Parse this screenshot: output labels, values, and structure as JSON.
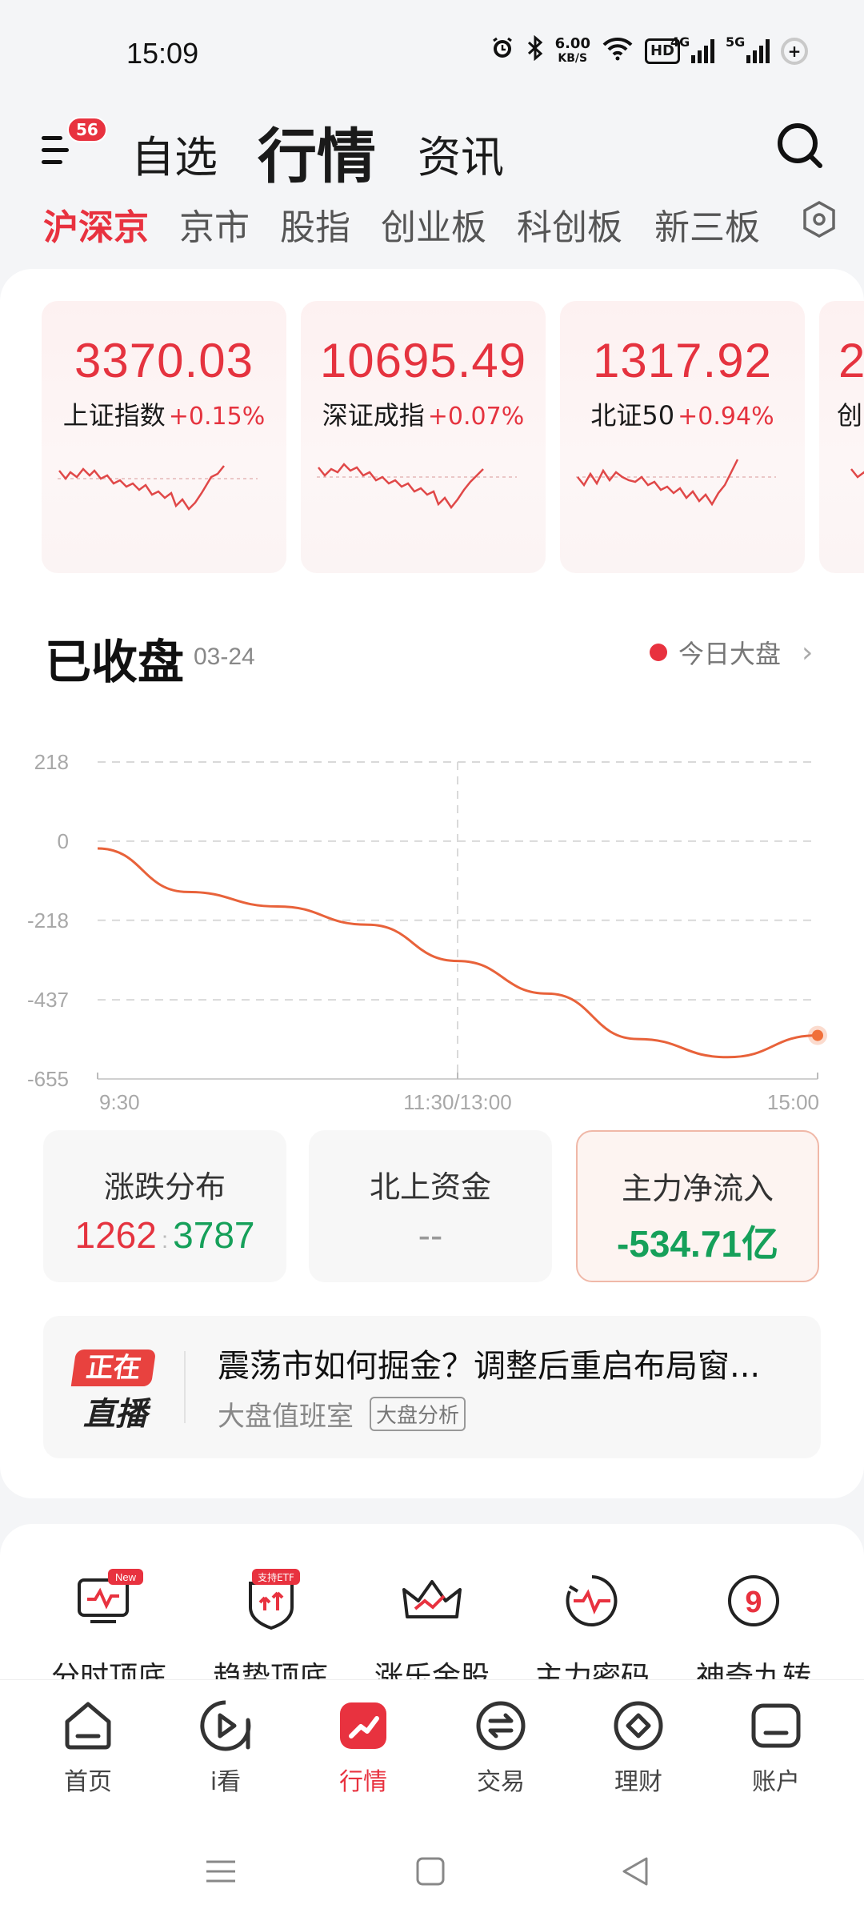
{
  "status_bar": {
    "time": "15:09",
    "net_speed_value": "6.00",
    "net_speed_unit": "KB/S",
    "hd_label": "HD",
    "signal1_label": "4G",
    "signal2_label": "5G",
    "battery_symbol": "+",
    "icons": [
      "alarm-icon",
      "bluetooth-icon",
      "wifi-icon",
      "hd-icon",
      "signal-icon",
      "battery-icon"
    ]
  },
  "header": {
    "menu_badge": "56",
    "tabs": [
      {
        "label": "自选",
        "active": false
      },
      {
        "label": "行情",
        "active": true
      },
      {
        "label": "资讯",
        "active": false
      }
    ],
    "search_icon": "search-icon"
  },
  "sub_tabs": [
    {
      "label": "沪深京",
      "active": true
    },
    {
      "label": "京市",
      "active": false
    },
    {
      "label": "股指",
      "active": false
    },
    {
      "label": "创业板",
      "active": false
    },
    {
      "label": "科创板",
      "active": false
    },
    {
      "label": "新三板",
      "active": false
    }
  ],
  "index_cards": [
    {
      "value": "3370.03",
      "name": "上证指数",
      "change": "+0.15%"
    },
    {
      "value": "10695.49",
      "name": "深证成指",
      "change": "+0.07%"
    },
    {
      "value": "1317.92",
      "name": "北证50",
      "change": "+0.94%"
    },
    {
      "value": "2",
      "name": "创",
      "change": ""
    }
  ],
  "market_section": {
    "title": "已收盘",
    "date": "03-24",
    "today_link": "今日大盘"
  },
  "chart_data": {
    "type": "line",
    "title": "",
    "y_ticks": [
      "218",
      "0",
      "-218",
      "-437",
      "-655"
    ],
    "x_ticks": [
      "9:30",
      "11:30/13:00",
      "15:00"
    ],
    "ylim": [
      -655,
      218
    ],
    "grid": true,
    "series": [
      {
        "x": [
          "9:30",
          "10:00",
          "10:30",
          "11:00",
          "11:30",
          "13:30",
          "14:00",
          "14:30",
          "15:00"
        ],
        "values": [
          -20,
          -140,
          -180,
          -230,
          -330,
          -420,
          -545,
          -595,
          -535
        ]
      }
    ],
    "line_color": "#e8623a"
  },
  "stats": {
    "distribution": {
      "title": "涨跌分布",
      "up": "1262",
      "sep": ":",
      "down": "3787"
    },
    "northbound": {
      "title": "北上资金",
      "value": "--"
    },
    "main_flow": {
      "title": "主力净流入",
      "value": "-534.71亿"
    }
  },
  "live": {
    "badge_top": "正在",
    "badge_bottom": "直播",
    "title": "震荡市如何掘金？调整后重启布局窗...",
    "source": "大盘值班室",
    "tag": "大盘分析"
  },
  "tools": [
    {
      "label": "分时顶底",
      "icon": "monitor-chart-icon",
      "badge": "New"
    },
    {
      "label": "趋势顶底",
      "icon": "shield-trend-icon",
      "badge": "支持ETF"
    },
    {
      "label": "涨乐金股",
      "icon": "crown-icon",
      "badge": ""
    },
    {
      "label": "主力密码",
      "icon": "pulse-circle-icon",
      "badge": ""
    },
    {
      "label": "神奇九转",
      "icon": "nine-circle-icon",
      "badge": ""
    }
  ],
  "bottom_nav": [
    {
      "label": "首页",
      "icon": "home-icon",
      "active": false
    },
    {
      "label": "i看",
      "icon": "play-icon",
      "active": false
    },
    {
      "label": "行情",
      "icon": "market-icon",
      "active": true
    },
    {
      "label": "交易",
      "icon": "trade-icon",
      "active": false
    },
    {
      "label": "理财",
      "icon": "finance-icon",
      "active": false
    },
    {
      "label": "账户",
      "icon": "account-icon",
      "active": false
    }
  ],
  "colors": {
    "accent_red": "#e8323f",
    "up_red": "#e5333f",
    "down_green": "#16a05a",
    "chart_line": "#e8623a"
  }
}
